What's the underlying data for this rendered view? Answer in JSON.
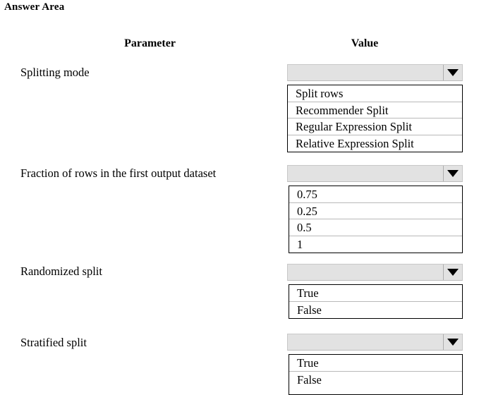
{
  "title": "Answer Area",
  "columns": {
    "parameter": "Parameter",
    "value": "Value"
  },
  "icons": {
    "dropdown_arrow": "chevron-down-icon"
  },
  "colors": {
    "combo_header_fill": "#e2e2e2",
    "combo_header_border": "#c8c8c8",
    "combo_list_border": "#000000",
    "option_separator": "#b9b9b9",
    "text": "#000000",
    "page_background": "#ffffff"
  },
  "rows": [
    {
      "label": "Splitting mode",
      "selected_value": "",
      "options": [
        "Split rows",
        "Recommender Split",
        "Regular Expression Split",
        "Relative Expression Split"
      ]
    },
    {
      "label": "Fraction of rows in the first output dataset",
      "selected_value": "",
      "options": [
        "0.75",
        "0.25",
        "0.5",
        "1"
      ]
    },
    {
      "label": "Randomized split",
      "selected_value": "",
      "options": [
        "True",
        "False"
      ]
    },
    {
      "label": "Stratified split",
      "selected_value": "",
      "options": [
        "True",
        "False"
      ]
    }
  ]
}
